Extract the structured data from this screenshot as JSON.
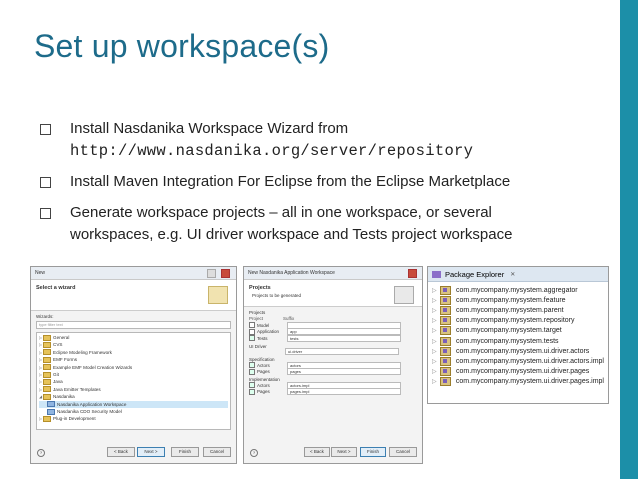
{
  "slide": {
    "title": "Set up workspace(s)",
    "accent_color": "#1c8fa8",
    "title_color": "#1d6b8a",
    "bullets": [
      {
        "line1": "Install Nasdanika Workspace Wizard from",
        "line2": "http://www.nasdanika.org/server/repository"
      },
      {
        "line1": "Install Maven Integration For Eclipse from the Eclipse Marketplace"
      },
      {
        "line1": "Generate workspace projects – all in one workspace, or several",
        "line2": "workspaces, e.g. UI driver workspace and Tests project workspace"
      }
    ]
  },
  "wizard": {
    "title": "New",
    "heading": "Select a wizard",
    "wizards_label": "Wizards:",
    "filter_placeholder": "type filter text",
    "tree": [
      "General",
      "CVS",
      "Eclipse Modeling Framework",
      "EMF Forms",
      "Example EMF Model Creation Wizards",
      "Git",
      "Java",
      "Java Emitter Templates",
      "Nasdanika",
      "Nasdanika Application Workspace",
      "Nasdanika CDO Security Model",
      "Plug-in Development"
    ],
    "buttons": {
      "back": "< Back",
      "next": "Next >",
      "finish": "Finish",
      "cancel": "Cancel"
    }
  },
  "workspace_wizard": {
    "title": "New Nasdanika Application Workspace",
    "heading": "Projects",
    "subheading": "Projects to be generated",
    "group_projects": "Projects",
    "col_project": "Project",
    "col_suffix": "Suffix",
    "rows": [
      {
        "label": "Model",
        "value": ""
      },
      {
        "label": "Application",
        "value": "app"
      },
      {
        "label": "Tests",
        "value": "tests"
      }
    ],
    "ui_driver_label": "UI Driver",
    "ui_driver_value": "ui.driver",
    "specification_label": "Specification",
    "spec_rows": [
      {
        "label": "Actors",
        "value": "actors"
      },
      {
        "label": "Pages",
        "value": "pages"
      }
    ],
    "implementation_label": "Implementation",
    "impl_rows": [
      {
        "label": "Actors",
        "value": "actors.impl"
      },
      {
        "label": "Pages",
        "value": "pages.impl"
      }
    ],
    "buttons": {
      "back": "< Back",
      "next": "Next >",
      "finish": "Finish",
      "cancel": "Cancel"
    }
  },
  "package_explorer": {
    "title": "Package Explorer",
    "close_glyph": "✕",
    "items": [
      "com.mycompany.mysystem.aggregator",
      "com.mycompany.mysystem.feature",
      "com.mycompany.mysystem.parent",
      "com.mycompany.mysystem.repository",
      "com.mycompany.mysystem.target",
      "com.mycompany.mysystem.tests",
      "com.mycompany.mysystem.ui.driver.actors",
      "com.mycompany.mysystem.ui.driver.actors.impl",
      "com.mycompany.mysystem.ui.driver.pages",
      "com.mycompany.mysystem.ui.driver.pages.impl"
    ]
  }
}
